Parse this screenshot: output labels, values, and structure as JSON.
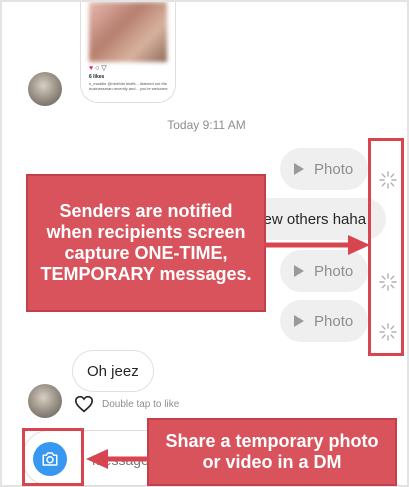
{
  "shared_post": {
    "likes": "6 likes",
    "caption": "k_maddie @nickhild bluffs... listened out the businessman recently and... you're welcome"
  },
  "conversation": {
    "timestamp": "Today 9:11 AM",
    "sent_messages": [
      {
        "type": "photo",
        "label": "Photo"
      },
      {
        "type": "text",
        "label": "A few others haha"
      },
      {
        "type": "photo",
        "label": "Photo"
      },
      {
        "type": "photo",
        "label": "Photo"
      }
    ],
    "received_message": "Oh jeez",
    "like_hint": "Double tap to like"
  },
  "composer": {
    "placeholder": "Message..."
  },
  "annotations": {
    "top_callout": "Senders are notified when recipients screen capture ONE-TIME, TEMPORARY messages.",
    "bottom_callout": "Share a temporary photo or video in a DM"
  },
  "colors": {
    "accent_red": "#d9535c",
    "highlight_red": "#d64550",
    "camera_blue": "#3897f0",
    "bubble_gray": "#efefef"
  }
}
